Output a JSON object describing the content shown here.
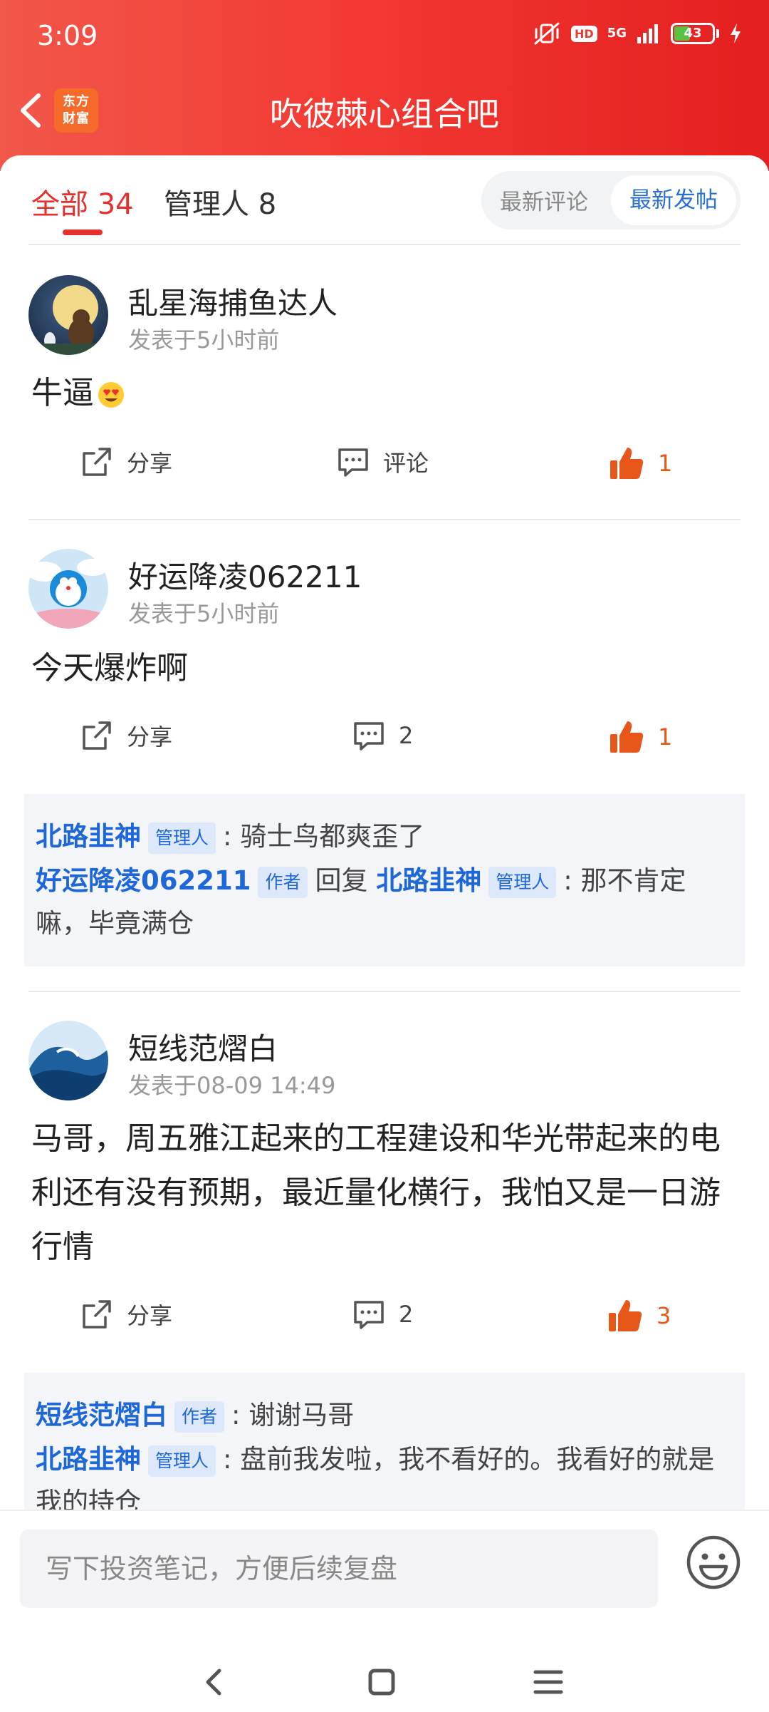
{
  "status": {
    "time": "3:09",
    "hd": "HD",
    "network": "5G",
    "battery": "43",
    "battery_level": 0.43
  },
  "header": {
    "title": "吹彼棘心组合吧",
    "logo_line1": "东方",
    "logo_line2": "财富"
  },
  "tabs": {
    "all": "全部 34",
    "admin": "管理人 8"
  },
  "sort": {
    "latest_comment": "最新评论",
    "latest_post": "最新发帖"
  },
  "labels": {
    "share": "分享",
    "comment": "评论"
  },
  "posts": [
    {
      "username": "乱星海捕鱼达人",
      "time": "发表于5小时前",
      "content": "牛逼",
      "comments": "评论",
      "likes": "1"
    },
    {
      "username": "好运降凌062211",
      "time": "发表于5小时前",
      "content": "今天爆炸啊",
      "comments": "2",
      "likes": "1",
      "replies": [
        {
          "user": "北路韭神",
          "badge": "管理人",
          "text": "骑士鸟都爽歪了"
        },
        {
          "user": "好运降凌062211",
          "badge": "作者",
          "reply_word": "回复",
          "target": "北路韭神",
          "target_badge": "管理人",
          "text": "那不肯定嘛，毕竟满仓"
        }
      ]
    },
    {
      "username": "短线范熠白",
      "time": "发表于08-09 14:49",
      "content": "马哥，周五雅江起来的工程建设和华光带起来的电利还有没有预期，最近量化横行，我怕又是一日游行情",
      "comments": "2",
      "likes": "3",
      "replies": [
        {
          "user": "短线范熠白",
          "badge": "作者",
          "text": "谢谢马哥"
        },
        {
          "user": "北路韭神",
          "badge": "管理人",
          "text": "盘前我发啦，我不看好的。我看好的就是我的持仓"
        }
      ]
    }
  ],
  "input": {
    "placeholder": "写下投资笔记，方便后续复盘"
  },
  "colors": {
    "header_red": "#f23a33",
    "accent_red": "#e3312f",
    "link_blue": "#1d67d8",
    "like_orange": "#e8571a"
  }
}
